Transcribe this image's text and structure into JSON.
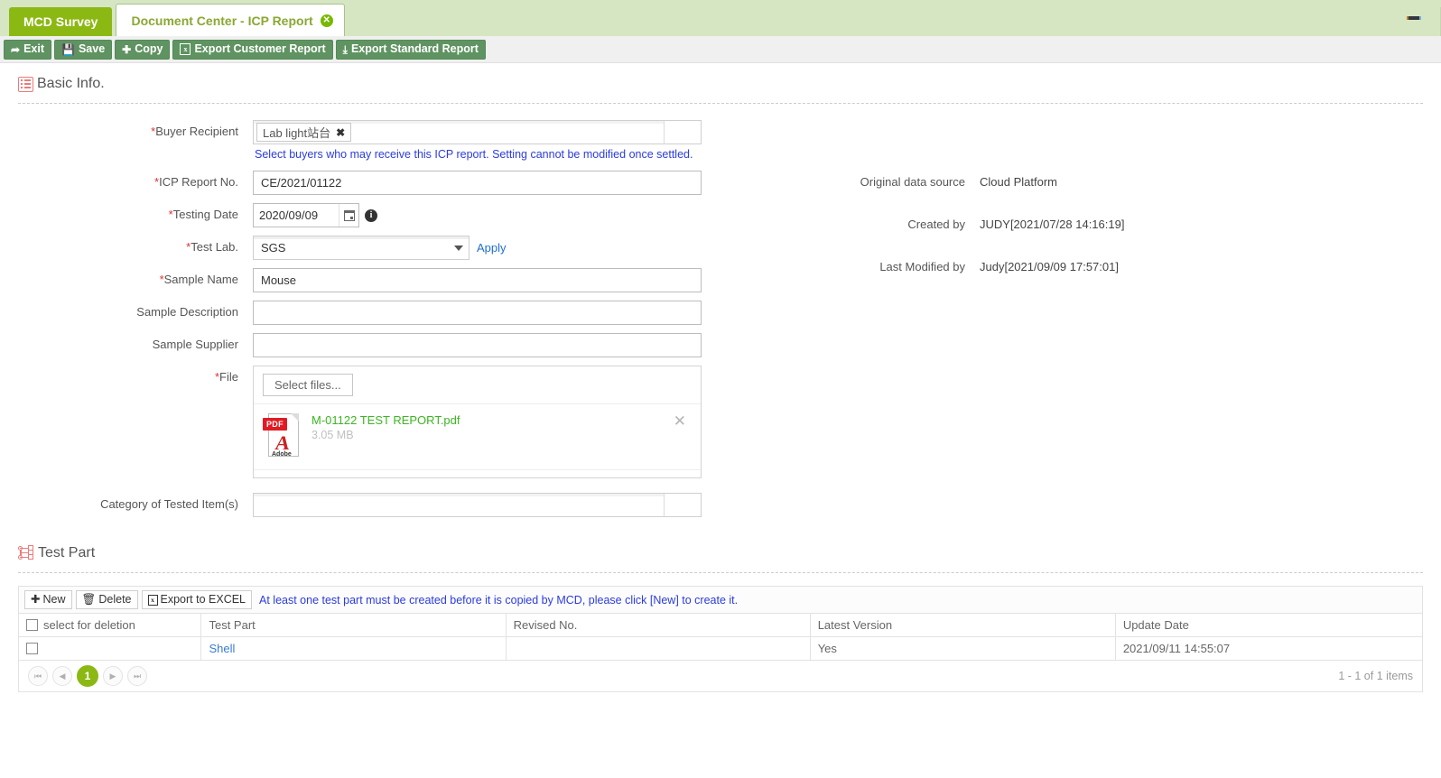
{
  "window": {
    "minimize_label": "—"
  },
  "tabs": [
    {
      "label": "MCD Survey",
      "active": false,
      "closable": false
    },
    {
      "label": "Document Center - ICP Report",
      "active": true,
      "closable": true,
      "close_glyph": "✕"
    }
  ],
  "toolbar": {
    "buttons": [
      {
        "label": "Exit",
        "icon": "exit-icon",
        "glyph": "↪"
      },
      {
        "label": "Save",
        "icon": "save-icon",
        "glyph": "Ὃe"
      },
      {
        "label": "Copy",
        "icon": "plus-icon",
        "glyph": "✚"
      },
      {
        "label": "Export Customer Report",
        "icon": "excel-icon",
        "glyph": "x"
      },
      {
        "label": "Export Standard Report",
        "icon": "download-icon",
        "glyph": "⤓"
      }
    ]
  },
  "basic_info": {
    "title": "Basic Info.",
    "icon": "list-icon",
    "fields": {
      "buyer_recipient": {
        "label": "Buyer Recipient",
        "required": true,
        "chips": [
          "Lab light站台"
        ],
        "chip_remove_glyph": "✖",
        "hint": "Select buyers who may receive this ICP report. Setting cannot be modified once settled."
      },
      "icp_report_no": {
        "label": "ICP Report No.",
        "required": true,
        "value": "CE/2021/01122"
      },
      "testing_date": {
        "label": "Testing Date",
        "required": true,
        "value": "2020/09/09",
        "info_glyph": "i"
      },
      "test_lab": {
        "label": "Test Lab.",
        "required": true,
        "value": "SGS",
        "apply_label": "Apply"
      },
      "sample_name": {
        "label": "Sample Name",
        "required": true,
        "value": "Mouse"
      },
      "sample_description": {
        "label": "Sample Description",
        "required": false,
        "value": ""
      },
      "sample_supplier": {
        "label": "Sample Supplier",
        "required": false,
        "value": ""
      },
      "file": {
        "label": "File",
        "required": true,
        "select_files_label": "Select files...",
        "items": [
          {
            "name": "M-01122 TEST REPORT.pdf",
            "size": "3.05 MB",
            "type_label": "PDF",
            "type_sub": "Adobe",
            "remove_glyph": "✕"
          }
        ]
      },
      "category_of_tested_items": {
        "label": "Category of Tested Item(s)",
        "required": false,
        "value": ""
      }
    },
    "meta": [
      {
        "label": "Original data source",
        "value": "Cloud Platform"
      },
      {
        "label": "Created by",
        "value": "JUDY[2021/07/28 14:16:19]"
      },
      {
        "label": "Last Modified by",
        "value": "Judy[2021/09/09 17:57:01]"
      }
    ]
  },
  "test_part": {
    "title": "Test Part",
    "icon": "tree-icon",
    "toolbar": {
      "new_label": "New",
      "delete_label": "Delete",
      "export_label": "Export to EXCEL",
      "note": "At least one test part must be created before it is copied by MCD, please click [New] to create it."
    },
    "table": {
      "columns": [
        "select for deletion",
        "Test Part",
        "Revised No.",
        "Latest Version",
        "Update Date"
      ],
      "rows": [
        {
          "selected": false,
          "test_part": "Shell",
          "revised_no": "",
          "latest_version": "Yes",
          "update_date": "2021/09/11 14:55:07"
        }
      ]
    },
    "pager": {
      "first_glyph": "⏮",
      "prev_glyph": "◀",
      "current_page": "1",
      "next_glyph": "▶",
      "last_glyph": "⏭",
      "info": "1 - 1 of 1 items"
    }
  },
  "colors": {
    "tab_bar_bg": "#d6e6c3",
    "tab_inactive_bg": "#8cb814",
    "tab_active_text": "#8aa832",
    "toolbar_button_bg": "#5f9361",
    "hint_text": "#2b3ce0",
    "link": "#3a7bd5",
    "required_star": "#e03131",
    "file_name": "#3cb521",
    "section_icon": "#ec7a7a",
    "pager_current": "#8cb814"
  }
}
